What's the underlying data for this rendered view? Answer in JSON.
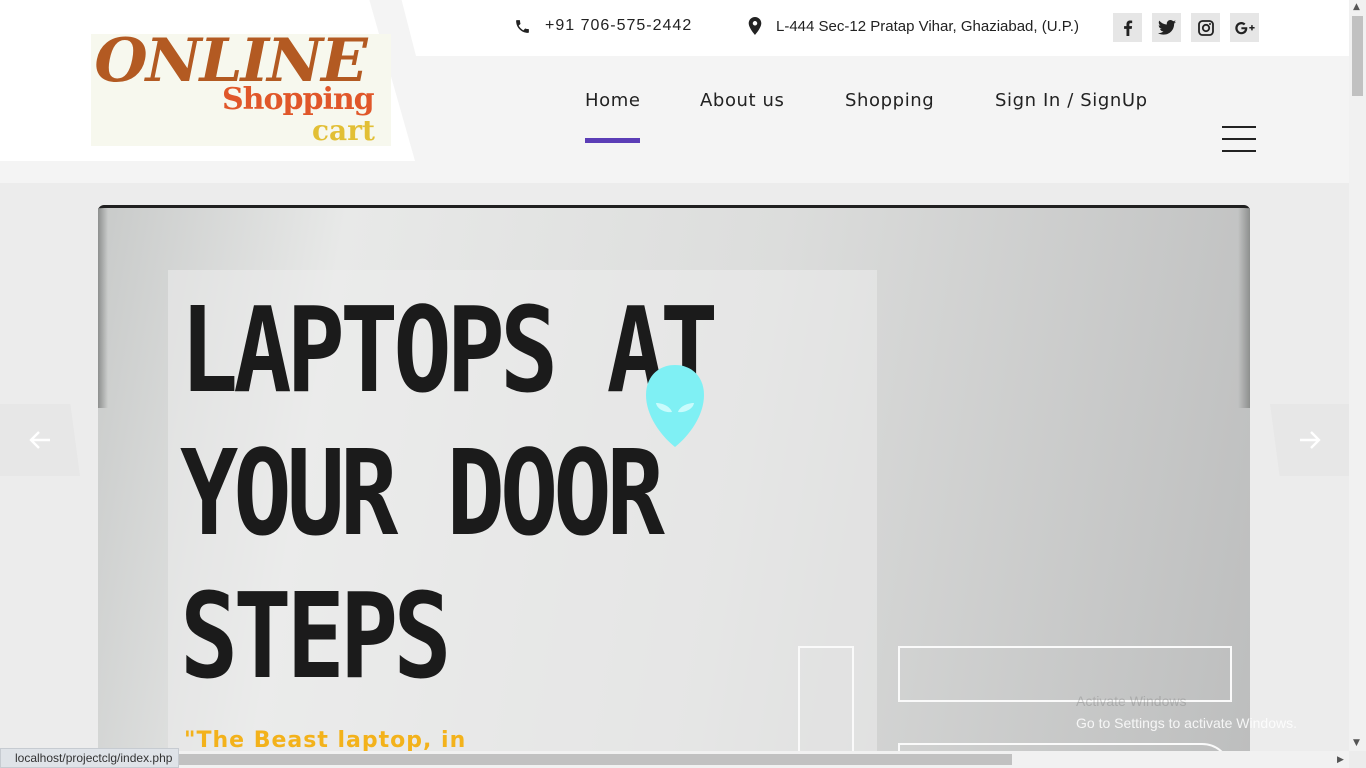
{
  "header": {
    "logo": {
      "line1": "ONLINE",
      "line2": "Shopping",
      "line3": "cart"
    },
    "phone": "+91 706-575-2442",
    "address": "L-444 Sec-12 Pratap Vihar, Ghaziabad, (U.P.)",
    "social": [
      "facebook-icon",
      "twitter-icon",
      "instagram-icon",
      "google-plus-icon"
    ]
  },
  "nav": {
    "items": [
      {
        "label": "Home",
        "active": true
      },
      {
        "label": "About us",
        "active": false
      },
      {
        "label": "Shopping",
        "active": false
      },
      {
        "label": "Sign In / SignUp",
        "active": false
      }
    ],
    "accent": "#5b3db6"
  },
  "hero": {
    "headline": [
      "LAPTOPS AT",
      "YOUR DOOR",
      "STEPS"
    ],
    "tagline": "\"The Beast laptop, in",
    "tagline_color": "#f3b21b"
  },
  "watermark": {
    "line1": "Activate Windows",
    "line2": "Go to Settings to activate Windows."
  },
  "status_bar": {
    "url": "localhost/projectclg/index.php"
  }
}
